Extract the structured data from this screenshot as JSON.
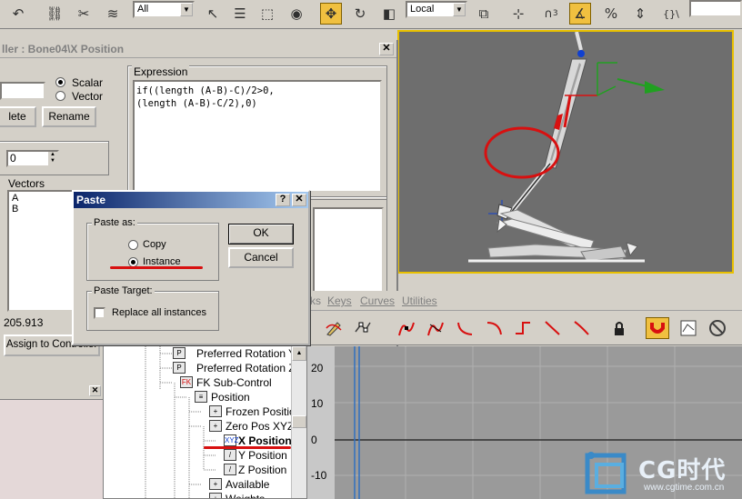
{
  "toolbar": {
    "filter_select": "All",
    "coord_select": "Local",
    "snap_angle_label": "3",
    "icons": [
      "undo-icon",
      "select-link-icon",
      "unlink-icon",
      "bind-space-warp-icon",
      "select-object-icon",
      "select-by-name-icon",
      "rect-selection-icon",
      "crossing-icon",
      "select-move-icon",
      "select-rotate-icon",
      "select-scale-icon",
      "pivot-center-icon",
      "mirror-icon",
      "snap-toggle-icon",
      "angle-snap-icon",
      "percent-snap-icon",
      "spinner-snap-icon",
      "named-selection-icon"
    ]
  },
  "expression_controller": {
    "title": "ller : Bone04\\X Position",
    "scalar_label": "Scalar",
    "vector_label": "Vector",
    "type_selected": "Scalar",
    "delete_label": "lete",
    "rename_label": "Rename",
    "spinner_value": "0",
    "vectors_label": "Vectors",
    "vectors": [
      "A",
      "B"
    ],
    "value_readout": "205.913",
    "assign_label": "Assign to Controller",
    "expression_label": "Expression",
    "expression_lines": [
      "if((length (A-B)-C)/2>0,",
      "(length (A-B)-C/2),0)"
    ]
  },
  "paste_dialog": {
    "title": "Paste",
    "help_icon": "?",
    "paste_as_label": "Paste as:",
    "copy_label": "Copy",
    "instance_label": "Instance",
    "selected": "Instance",
    "paste_target_label": "Paste Target:",
    "replace_label": "Replace all instances",
    "replace_checked": false,
    "ok_label": "OK",
    "cancel_label": "Cancel"
  },
  "track_view": {
    "menu": [
      "ks",
      "Keys",
      "Curves",
      "Utilities"
    ],
    "tree": [
      {
        "label": "Preferred Rotation Y",
        "icon": "P"
      },
      {
        "label": "Preferred Rotation Z",
        "icon": "P"
      },
      {
        "label": "FK Sub-Control",
        "icon": "FK"
      },
      {
        "label": "Position",
        "icon": "≡"
      },
      {
        "label": "Frozen Position",
        "icon": "+"
      },
      {
        "label": "Zero Pos XYZ",
        "icon": "+"
      },
      {
        "label": "X Position",
        "icon": "XYZ"
      },
      {
        "label": "Y Position",
        "icon": "/"
      },
      {
        "label": "Z Position",
        "icon": "/"
      },
      {
        "label": "Available",
        "icon": "+"
      },
      {
        "label": "Weights",
        "icon": "+"
      }
    ],
    "selected_item": "X Position",
    "y_ticks": [
      "20",
      "10",
      "0",
      "-10"
    ]
  },
  "watermark": {
    "brand": "CG时代",
    "url": "www.cgtime.com.cn"
  },
  "colors": {
    "annotation_red": "#d81010",
    "active_yellow": "#f0c040",
    "title_blue": "#0a246a",
    "viewport_gray": "#6e6e6e"
  }
}
